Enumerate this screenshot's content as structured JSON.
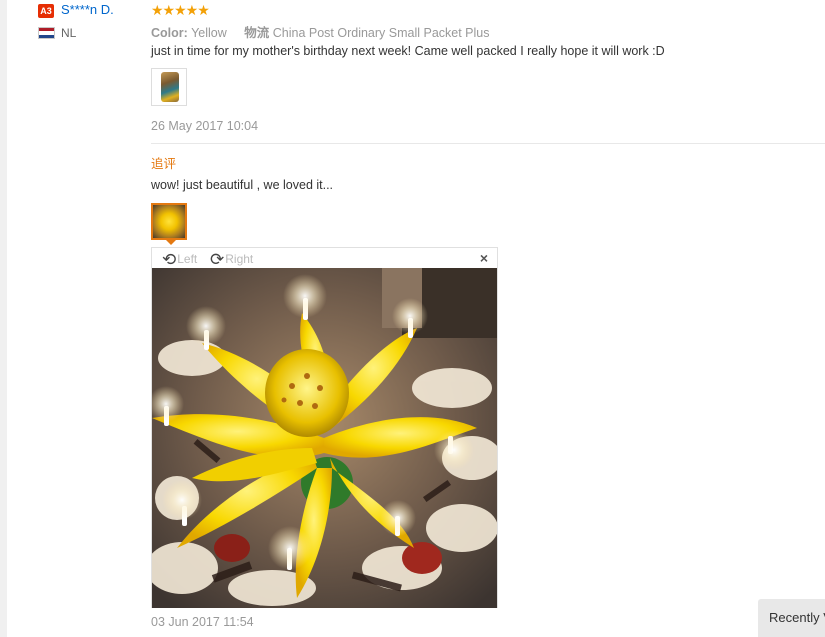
{
  "reviewer": {
    "badge": "A3",
    "name": "S****n D.",
    "country": "NL",
    "flag_colors": [
      "#ae1c28",
      "#ffffff",
      "#21468b"
    ]
  },
  "review": {
    "rating_stars": 5,
    "stars_glyphs": "★★★★★",
    "color_label": "Color:",
    "color_value": "Yellow",
    "logistics_label": "物流",
    "logistics_value": "China Post Ordinary Small Packet Plus",
    "text": "just in time for my mother's birthday next week! Came well packed I really hope it will work :D",
    "date": "26 May 2017 10:04"
  },
  "additional_feedback": {
    "label": "追评",
    "text": "wow! just beautiful , we loved it...",
    "date": "03 Jun 2017 11:54"
  },
  "image_viewer": {
    "rotate_left_label": "Left",
    "rotate_right_label": "Right",
    "rotate_left_icon": "rotate-left-icon",
    "rotate_right_icon": "rotate-right-icon",
    "close_glyph": "×"
  },
  "recently_viewed": {
    "label": "Recently V"
  },
  "colors": {
    "accent_orange": "#e47911",
    "star_orange": "#f3a108",
    "link_blue": "#0066cc",
    "badge_red": "#e62e04"
  }
}
